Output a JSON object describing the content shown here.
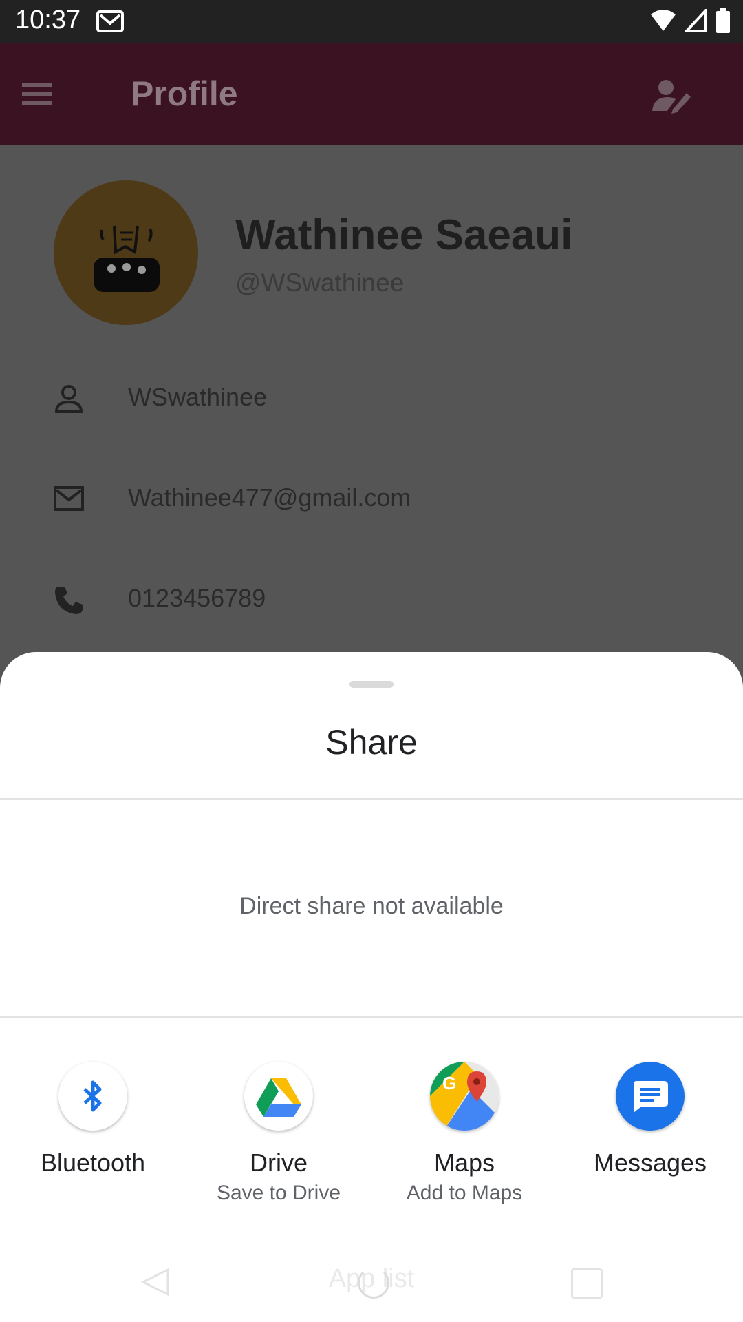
{
  "status_bar": {
    "time": "10:37"
  },
  "app_bar": {
    "title": "Profile"
  },
  "profile": {
    "name": "Wathinee Saeaui",
    "handle": "@WSwathinee",
    "username": "WSwathinee",
    "email": "Wathinee477@gmail.com",
    "phone": "0123456789"
  },
  "share_sheet": {
    "title": "Share",
    "direct_share_message": "Direct share not available",
    "targets": [
      {
        "label": "Bluetooth",
        "sublabel": "",
        "icon": "bluetooth-icon"
      },
      {
        "label": "Drive",
        "sublabel": "Save to Drive",
        "icon": "google-drive-icon"
      },
      {
        "label": "Maps",
        "sublabel": "Add to Maps",
        "icon": "google-maps-icon"
      },
      {
        "label": "Messages",
        "sublabel": "",
        "icon": "messages-icon"
      }
    ]
  },
  "nav_bar": {
    "center_label": "App list"
  },
  "colors": {
    "app_bar": "#3b1222",
    "scrim_content": "#555555",
    "sheet": "#ffffff"
  }
}
